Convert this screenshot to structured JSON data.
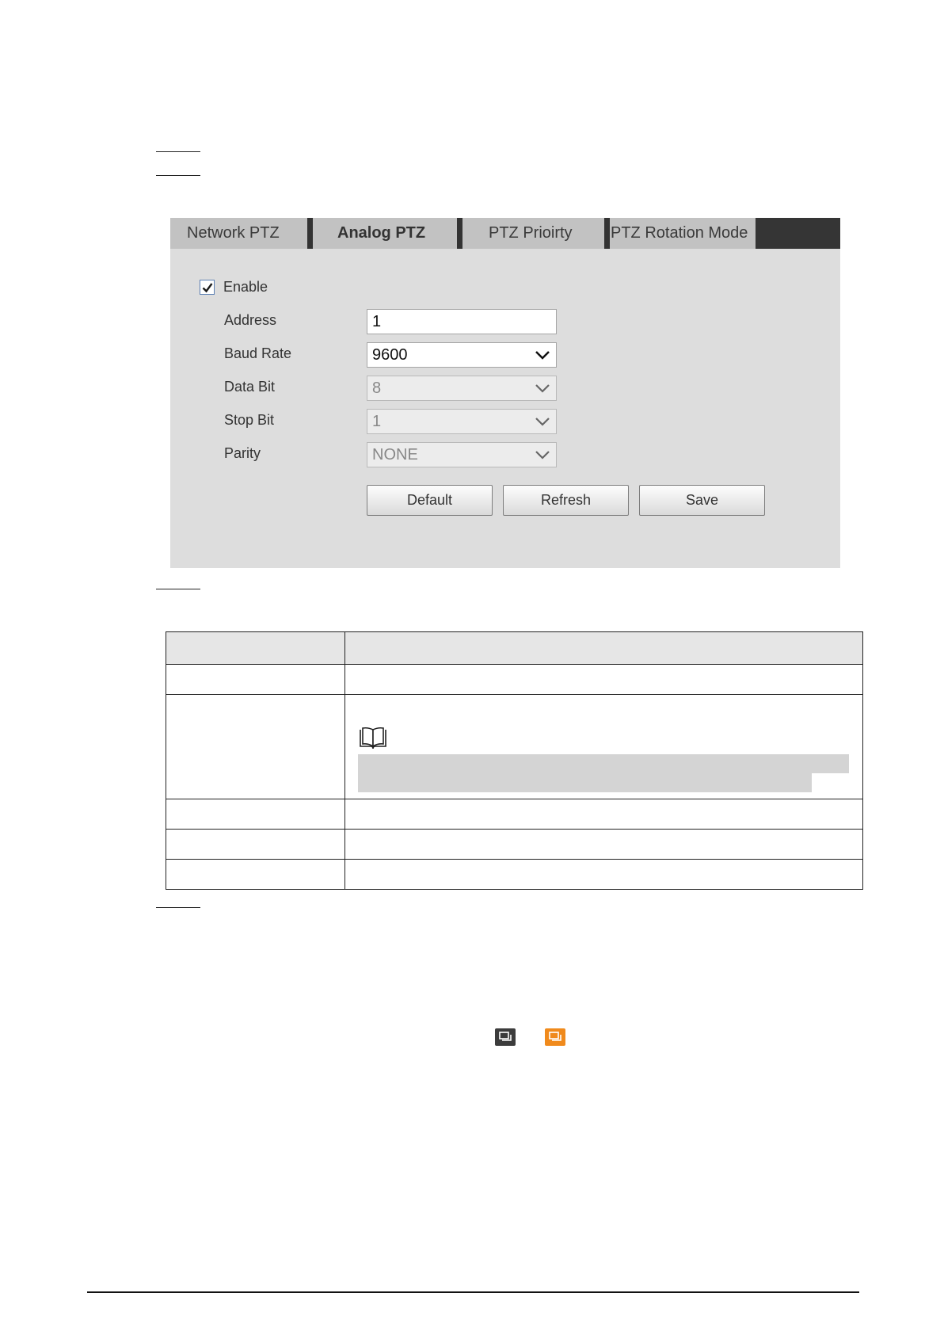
{
  "tabs": [
    {
      "label": "Network PTZ",
      "active": false
    },
    {
      "label": "Analog PTZ",
      "active": true
    },
    {
      "label": "PTZ Prioirty",
      "active": false
    },
    {
      "label": "PTZ Rotation Mode",
      "active": false
    }
  ],
  "form": {
    "enable": {
      "label": "Enable",
      "checked": true
    },
    "address": {
      "label": "Address",
      "value": "1"
    },
    "baud_rate": {
      "label": "Baud Rate",
      "value": "9600"
    },
    "data_bit": {
      "label": "Data Bit",
      "value": "8",
      "disabled": true
    },
    "stop_bit": {
      "label": "Stop Bit",
      "value": "1",
      "disabled": true
    },
    "parity": {
      "label": "Parity",
      "value": "NONE",
      "disabled": true
    }
  },
  "buttons": {
    "default": "Default",
    "refresh": "Refresh",
    "save": "Save"
  },
  "colors": {
    "panel_bg": "#dddddd",
    "tabbar_bg": "#c2c2c2",
    "tab_separator": "#333333",
    "icon_orange": "#f08a1c",
    "icon_dark": "#3c3c3c"
  },
  "icons": [
    "checkmark-icon",
    "chevron-down-icon",
    "note-book-icon",
    "ptz-control-icon"
  ]
}
